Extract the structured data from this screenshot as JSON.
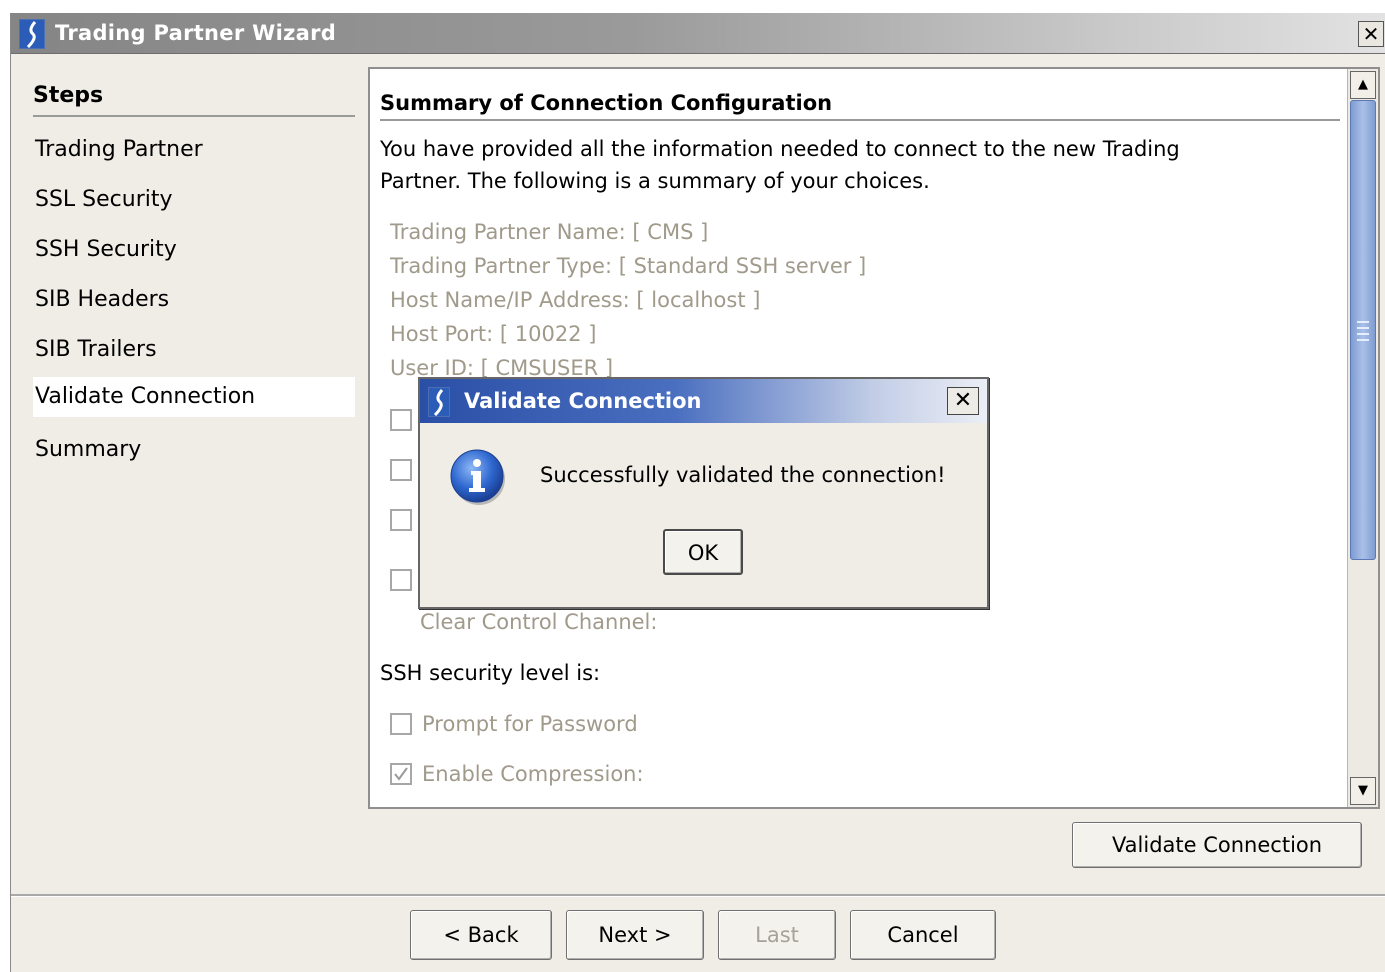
{
  "window": {
    "title": "Trading Partner Wizard",
    "close_glyph": "✕"
  },
  "steps": {
    "header": "Steps",
    "items": [
      {
        "label": "Trading Partner"
      },
      {
        "label": "SSL Security"
      },
      {
        "label": "SSH Security"
      },
      {
        "label": "SIB Headers"
      },
      {
        "label": "SIB Trailers"
      },
      {
        "label": "Validate Connection",
        "active": true
      },
      {
        "label": "Summary"
      }
    ]
  },
  "summary": {
    "title": "Summary of Connection Configuration",
    "intro_line1": "You have provided all the information needed to connect to the new Trading",
    "intro_line2": "Partner. The following is a summary of your choices.",
    "fields": [
      "Trading Partner Name: [ CMS ]",
      "Trading Partner Type: [ Standard SSH server ]",
      "Host Name/IP Address: [ localhost ]",
      "Host Port: [ 10022 ]",
      "User ID: [ CMSUSER ]"
    ],
    "clear_control_channel": "Clear Control Channel:",
    "ssh_section": "SSH security level is:",
    "prompt_password": {
      "label": "Prompt for Password",
      "checked": false
    },
    "enable_compression": {
      "label": "Enable Compression:",
      "checked": true
    }
  },
  "buttons": {
    "validate_connection": "Validate Connection",
    "back": "< Back",
    "next": "Next >",
    "last": "Last",
    "cancel": "Cancel"
  },
  "dialog": {
    "title": "Validate Connection",
    "message": "Successfully validated the connection!",
    "ok": "OK",
    "icon": "info-icon"
  },
  "colors": {
    "selection_blue": "#2a4fa6",
    "disabled_text": "#a09a8b"
  }
}
